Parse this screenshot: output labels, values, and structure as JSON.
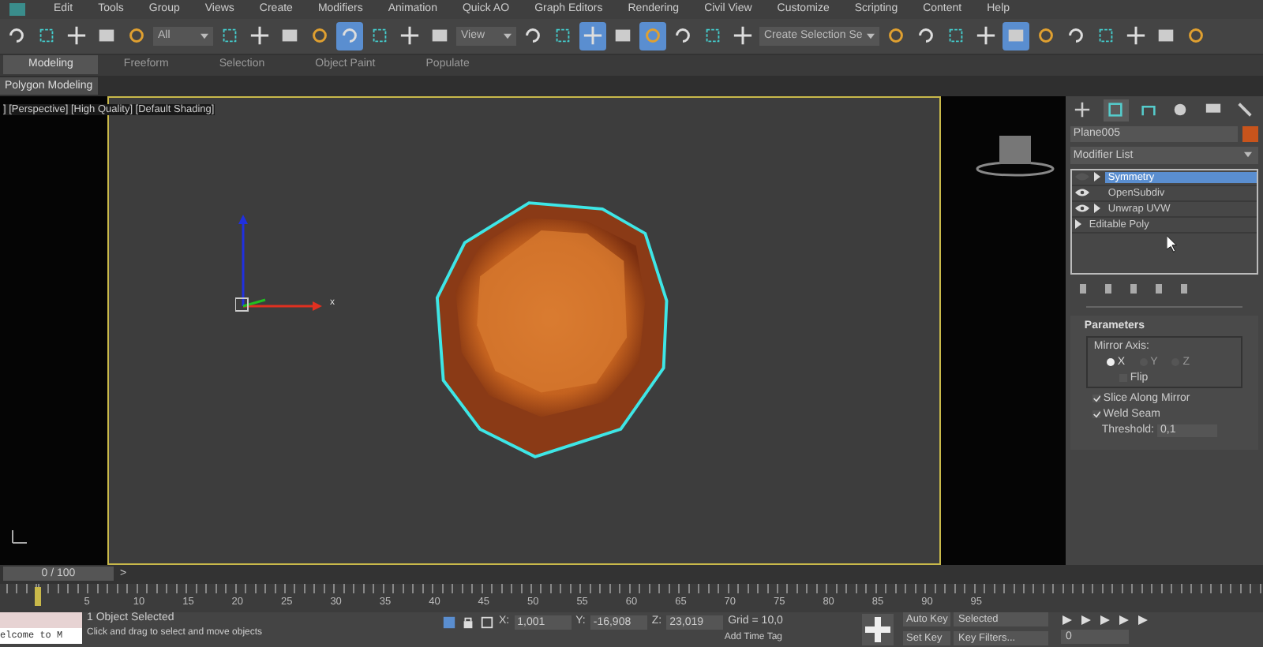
{
  "menu": [
    "Edit",
    "Tools",
    "Group",
    "Views",
    "Create",
    "Modifiers",
    "Animation",
    "Quick AO",
    "Graph Editors",
    "Rendering",
    "Civil View",
    "Customize",
    "Scripting",
    "Content",
    "Help"
  ],
  "toolbar": [
    {
      "kind": "button",
      "selected": false
    },
    {
      "kind": "button",
      "selected": false
    },
    {
      "kind": "button",
      "selected": false
    },
    {
      "kind": "button",
      "selected": false
    },
    {
      "kind": "button",
      "selected": false
    },
    {
      "kind": "dropdown",
      "value": "All"
    },
    {
      "kind": "button",
      "selected": false
    },
    {
      "kind": "button",
      "selected": false
    },
    {
      "kind": "button",
      "selected": false
    },
    {
      "kind": "button",
      "selected": false
    },
    {
      "kind": "button",
      "selected": true
    },
    {
      "kind": "button",
      "selected": false
    },
    {
      "kind": "button",
      "selected": false
    },
    {
      "kind": "button",
      "selected": false
    },
    {
      "kind": "dropdown",
      "value": "View"
    },
    {
      "kind": "button",
      "selected": false
    },
    {
      "kind": "button",
      "selected": false
    },
    {
      "kind": "button",
      "selected": true
    },
    {
      "kind": "button",
      "selected": false
    },
    {
      "kind": "button",
      "selected": true
    },
    {
      "kind": "button",
      "selected": false
    },
    {
      "kind": "button",
      "selected": false
    },
    {
      "kind": "button",
      "selected": false
    },
    {
      "kind": "dropdown",
      "value": "Create Selection Se"
    },
    {
      "kind": "button",
      "selected": false
    },
    {
      "kind": "button",
      "selected": false
    },
    {
      "kind": "button",
      "selected": false
    },
    {
      "kind": "button",
      "selected": false
    },
    {
      "kind": "button",
      "selected": true
    },
    {
      "kind": "button",
      "selected": false
    },
    {
      "kind": "button",
      "selected": false
    },
    {
      "kind": "button",
      "selected": false
    },
    {
      "kind": "button",
      "selected": false
    },
    {
      "kind": "button",
      "selected": false
    },
    {
      "kind": "button",
      "selected": false
    }
  ],
  "ribbon_tabs": [
    {
      "label": "Modeling",
      "selected": true
    },
    {
      "label": "Freeform",
      "selected": false
    },
    {
      "label": "Selection",
      "selected": false
    },
    {
      "label": "Object Paint",
      "selected": false
    },
    {
      "label": "Populate",
      "selected": false
    }
  ],
  "ribbon_panel": "Polygon Modeling",
  "viewport": {
    "label": "] [Perspective] [High Quality] [Default Shading]",
    "axis_label": "x"
  },
  "command_panel": {
    "tabs": [
      {
        "selected": false
      },
      {
        "selected": true
      },
      {
        "selected": false
      },
      {
        "selected": false
      },
      {
        "selected": false
      },
      {
        "selected": false
      }
    ],
    "object_name": "Plane005",
    "modifier_list": "Modifier List",
    "stack": [
      {
        "kind": "modifier",
        "label": "Symmetry",
        "visible": false,
        "expandable": true,
        "selected": true
      },
      {
        "kind": "modifier",
        "label": "OpenSubdiv",
        "visible": true,
        "expandable": false,
        "selected": false
      },
      {
        "kind": "modifier",
        "label": "Unwrap UVW",
        "visible": true,
        "expandable": true,
        "selected": false
      },
      {
        "kind": "base",
        "label": "Editable Poly",
        "expandable": true,
        "selected": false
      }
    ],
    "rollout": {
      "title": "Parameters",
      "group": "Mirror Axis:",
      "axes": [
        {
          "label": "X",
          "selected": true
        },
        {
          "label": "Y",
          "selected": false
        },
        {
          "label": "Z",
          "selected": false
        }
      ],
      "flip": {
        "label": "Flip",
        "checked": false
      },
      "options": [
        {
          "label": "Slice Along Mirror",
          "checked": true
        },
        {
          "label": "Weld Seam",
          "checked": true
        }
      ],
      "threshold": {
        "label": "Threshold:",
        "value": "0,1"
      }
    }
  },
  "timeline": {
    "frame": "0 / 100",
    "next": ">",
    "ticks": [
      "5",
      "10",
      "15",
      "20",
      "25",
      "30",
      "35",
      "40",
      "45",
      "50",
      "55",
      "60",
      "65",
      "70",
      "75",
      "80",
      "85",
      "90",
      "95"
    ]
  },
  "status": {
    "listener": "elcome to M",
    "selection": "1 Object Selected",
    "prompt": "Click and drag to select and move objects",
    "coords": [
      {
        "label": "X:",
        "value": "1,001"
      },
      {
        "label": "Y:",
        "value": "-16,908"
      },
      {
        "label": "Z:",
        "value": "23,019"
      }
    ],
    "grid": "Grid = 10,0",
    "time_tag": "Add Time Tag",
    "auto_key": "Auto Key",
    "key_mode": "Selected",
    "set_key": "Set Key",
    "key_filters": "Key Filters...",
    "current_frame": "0"
  }
}
